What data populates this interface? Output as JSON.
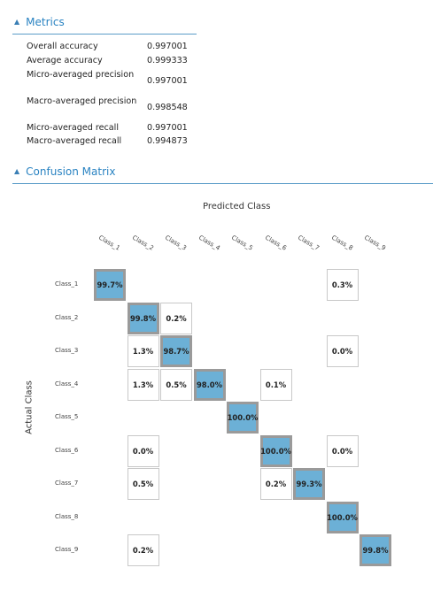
{
  "metrics": {
    "title": "Metrics",
    "rows": [
      {
        "label": "Overall accuracy",
        "value": "0.997001"
      },
      {
        "label": "Average accuracy",
        "value": "0.999333"
      },
      {
        "label": "Micro-averaged precision",
        "value": "0.997001"
      },
      {
        "label": "Macro-averaged precision",
        "value": "0.998548"
      },
      {
        "label": "Micro-averaged recall",
        "value": "0.997001"
      },
      {
        "label": "Macro-averaged recall",
        "value": "0.994873"
      }
    ]
  },
  "confusion": {
    "title": "Confusion Matrix",
    "predicted_label": "Predicted Class",
    "actual_label": "Actual Class",
    "col_labels": [
      "Class_1",
      "Class_2",
      "Class_3",
      "Class_4",
      "Class_5",
      "Class_6",
      "Class_7",
      "Class_8",
      "Class_9"
    ],
    "row_labels": [
      "Class_1",
      "Class_2",
      "Class_3",
      "Class_4",
      "Class_5",
      "Class_6",
      "Class_7",
      "Class_8",
      "Class_9"
    ],
    "cells": [
      {
        "row": 0,
        "col": 0,
        "text": "99.7%"
      },
      {
        "row": 0,
        "col": 7,
        "text": "0.3%"
      },
      {
        "row": 1,
        "col": 1,
        "text": "99.8%"
      },
      {
        "row": 1,
        "col": 2,
        "text": "0.2%"
      },
      {
        "row": 2,
        "col": 1,
        "text": "1.3%"
      },
      {
        "row": 2,
        "col": 2,
        "text": "98.7%"
      },
      {
        "row": 2,
        "col": 7,
        "text": "0.0%"
      },
      {
        "row": 3,
        "col": 1,
        "text": "1.3%"
      },
      {
        "row": 3,
        "col": 2,
        "text": "0.5%"
      },
      {
        "row": 3,
        "col": 3,
        "text": "98.0%"
      },
      {
        "row": 3,
        "col": 5,
        "text": "0.1%"
      },
      {
        "row": 4,
        "col": 4,
        "text": "100.0%"
      },
      {
        "row": 5,
        "col": 1,
        "text": "0.0%"
      },
      {
        "row": 5,
        "col": 5,
        "text": "100.0%"
      },
      {
        "row": 5,
        "col": 7,
        "text": "0.0%"
      },
      {
        "row": 6,
        "col": 1,
        "text": "0.5%"
      },
      {
        "row": 6,
        "col": 5,
        "text": "0.2%"
      },
      {
        "row": 6,
        "col": 6,
        "text": "99.3%"
      },
      {
        "row": 7,
        "col": 7,
        "text": "100.0%"
      },
      {
        "row": 8,
        "col": 1,
        "text": "0.2%"
      },
      {
        "row": 8,
        "col": 8,
        "text": "99.8%"
      }
    ]
  },
  "colors": {
    "accent": "#2a83c2",
    "diag_fill": "#6cb0d6",
    "diag_border": "#9a9a9a",
    "cell_border": "#c8c8c8"
  }
}
